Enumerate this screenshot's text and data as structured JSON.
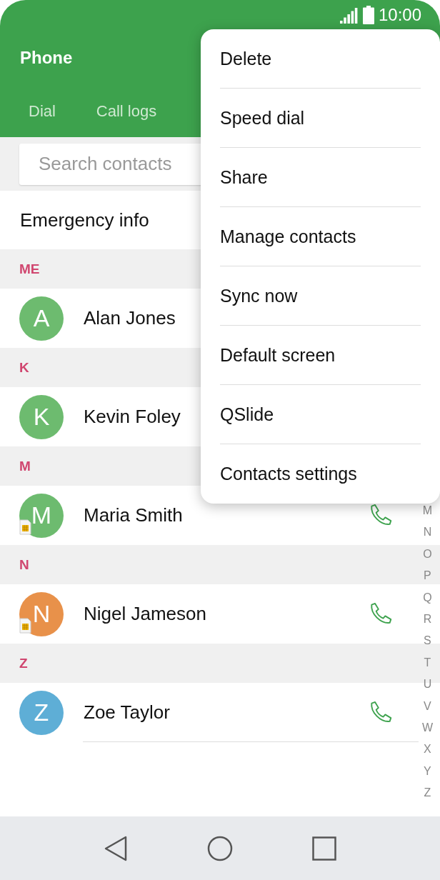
{
  "status_bar": {
    "time": "10:00"
  },
  "header": {
    "title": "Phone",
    "tabs": [
      {
        "label": "Dial"
      },
      {
        "label": "Call logs"
      }
    ]
  },
  "search": {
    "placeholder": "Search contacts"
  },
  "emergency": {
    "label": "Emergency info"
  },
  "sections": [
    {
      "letter": "ME",
      "contacts": [
        {
          "initial": "A",
          "name": "Alan Jones",
          "color": "#6dbb6f",
          "sim": false,
          "call_button": false
        }
      ]
    },
    {
      "letter": "K",
      "contacts": [
        {
          "initial": "K",
          "name": "Kevin Foley",
          "color": "#6dbb6f",
          "sim": false,
          "call_button": false
        }
      ]
    },
    {
      "letter": "M",
      "contacts": [
        {
          "initial": "M",
          "name": "Maria Smith",
          "color": "#6dbb6f",
          "sim": true,
          "call_button": true
        }
      ]
    },
    {
      "letter": "N",
      "contacts": [
        {
          "initial": "N",
          "name": "Nigel Jameson",
          "color": "#e8914a",
          "sim": true,
          "call_button": true
        }
      ]
    },
    {
      "letter": "Z",
      "contacts": [
        {
          "initial": "Z",
          "name": "Zoe Taylor",
          "color": "#5eaed6",
          "sim": false,
          "call_button": true
        }
      ]
    }
  ],
  "index": [
    "M",
    "N",
    "O",
    "P",
    "Q",
    "R",
    "S",
    "T",
    "U",
    "V",
    "W",
    "X",
    "Y",
    "Z"
  ],
  "menu": [
    "Delete",
    "Speed dial",
    "Share",
    "Manage contacts",
    "Sync now",
    "Default screen",
    "QSlide",
    "Contacts settings"
  ]
}
